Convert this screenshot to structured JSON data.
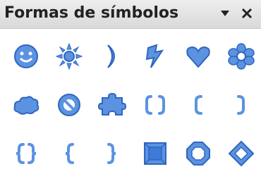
{
  "window": {
    "title": "Formas de símbolos",
    "menu_icon": "dropdown-triangle-icon",
    "close_icon": "close-icon"
  },
  "colors": {
    "shape_fill": "#5b93e0",
    "shape_stroke": "#2f66c0",
    "titlebar_bg": "#e4e4e4"
  },
  "symbols": [
    {
      "icon": "smiley-face-icon"
    },
    {
      "icon": "sun-icon"
    },
    {
      "icon": "moon-icon"
    },
    {
      "icon": "lightning-bolt-icon"
    },
    {
      "icon": "heart-icon"
    },
    {
      "icon": "flower-icon"
    },
    {
      "icon": "cloud-icon"
    },
    {
      "icon": "prohibited-symbol-icon"
    },
    {
      "icon": "puzzle-icon"
    },
    {
      "icon": "double-bracket-icon"
    },
    {
      "icon": "left-bracket-icon"
    },
    {
      "icon": "right-bracket-icon"
    },
    {
      "icon": "double-brace-icon"
    },
    {
      "icon": "left-brace-icon"
    },
    {
      "icon": "right-brace-icon"
    },
    {
      "icon": "square-bevel-icon"
    },
    {
      "icon": "octagon-bevel-icon"
    },
    {
      "icon": "diamond-bevel-icon"
    }
  ]
}
